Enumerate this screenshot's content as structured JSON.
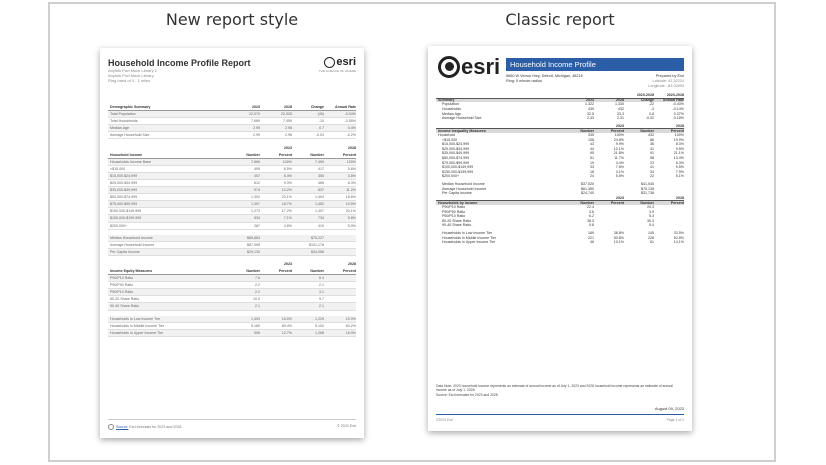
{
  "captions": {
    "new": "New report style",
    "classic": "Classic report"
  },
  "new_report": {
    "title": "Household Income Profile Report",
    "subtitle_lines": [
      "Anyfolk Port Mock Library 2",
      "Anyfolk Port Mock Library",
      "Ring band of 0 - 1 miles"
    ],
    "logo_text": "esri",
    "logo_tagline": "THE SCIENCE OF WHERE",
    "demographic": {
      "header": [
        "Demographic Summary",
        "2023",
        "2028",
        "Change",
        "Annual Rate"
      ],
      "rows": [
        [
          "Total Population",
          "22,970",
          "22,925",
          "(45)",
          "-0.04%"
        ],
        [
          "Total Households",
          "7,669",
          "7,459",
          "-10",
          "-0.55%"
        ],
        [
          "Median Age",
          "2.99",
          "2.96",
          "0.7",
          "0.4%"
        ],
        [
          "Average Household Size",
          "2.99",
          "2.96",
          "-0.03",
          "-0.2%"
        ]
      ]
    },
    "income": {
      "years": [
        "2023",
        "2028"
      ],
      "header": [
        "Household Income",
        "Number",
        "Percent",
        "Number",
        "Percent"
      ],
      "rows": [
        [
          "Households Income Base",
          "7,869",
          "100%",
          "7,459",
          "100%"
        ],
        [
          "<$15,000",
          "495",
          "6.5%",
          "417",
          "5.6%"
        ],
        [
          "$15,000-$24,999",
          "407",
          "5.4%",
          "350",
          "3.8%"
        ],
        [
          "$25,000-$34,999",
          "612",
          "9.3%",
          "465",
          "6.3%"
        ],
        [
          "$35,000-$49,999",
          "974",
          "13.2%",
          "837",
          "11.2%"
        ],
        [
          "$50,000-$74,999",
          "1,302",
          "20.1%",
          "1,404",
          "18.8%"
        ],
        [
          "$75,000-$99,999",
          "1,397",
          "18.7%",
          "1,452",
          "19.5%"
        ],
        [
          "$100,000-$149,999",
          "1,273",
          "17.2%",
          "1,497",
          "20.1%"
        ],
        [
          "$150,000-$199,999",
          "534",
          "7.1%",
          "734",
          "9.8%"
        ],
        [
          "$200,000+",
          "287",
          "3.8%",
          "410",
          "5.0%"
        ]
      ],
      "summary": [
        [
          "Median Household Income",
          "$65,863",
          "$75,227"
        ],
        [
          "Average Household Income",
          "$87,059",
          "$101,178"
        ],
        [
          "Per Capita Income",
          "$29,130",
          "$34,056"
        ]
      ]
    },
    "equity": {
      "years": [
        "2023",
        "2028"
      ],
      "header": [
        "Income Equity Measures",
        "Number",
        "Percent",
        "Number",
        "Percent"
      ],
      "rows": [
        [
          "P90/P10 Ratio",
          "7.6",
          "",
          "6.4",
          ""
        ],
        [
          "P90/P50 Ratio",
          "2.2",
          "",
          "2.1",
          ""
        ],
        [
          "P50/P10 Ratio",
          "2.2",
          "",
          "3.1",
          ""
        ],
        [
          "80-20 Share Ratio",
          "10.0",
          "",
          "9.7",
          ""
        ],
        [
          "90-40 Share Ratio",
          "2.1",
          "",
          "2.1",
          ""
        ]
      ],
      "tiers": [
        [
          "Households in Low Income Tier",
          "1,393",
          "18.5%",
          "1,229",
          "15.9%"
        ],
        [
          "Households in Middle Income Tier",
          "5,180",
          "69.4%",
          "5,102",
          "69.2%"
        ],
        [
          "Households in Upper Income Tier",
          "996",
          "12.7%",
          "1,258",
          "16.9%"
        ]
      ]
    },
    "footer": {
      "source_label": "Source:",
      "source_text": "Esri forecasts for 2023 and 2028.",
      "copyright": "© 2023 Esri"
    }
  },
  "classic_report": {
    "logo_text": "esri",
    "title": "Household Income Profile",
    "address_lines": [
      "5660 W Vernor Hwy, Detroit, Michigan, 48216",
      "Ring: 5 minute radius"
    ],
    "prepared": [
      "Prepared by Esri",
      "Latitude: 42.32224",
      "Longitude: -83.02893"
    ],
    "summary_years": [
      "2023-2028",
      "2023-2028"
    ],
    "summary_header": [
      "Summary",
      "2023",
      "2028",
      "Change",
      "Annual Rate"
    ],
    "summary_rows": [
      [
        "Population",
        "1,322",
        "1,330",
        "-22",
        "-0.43%"
      ],
      [
        "Households",
        "435",
        "432",
        "-3",
        "-0.14%"
      ],
      [
        "Median Age",
        "32.5",
        "33.3",
        "0.8",
        "0.37%"
      ],
      [
        "Average Household Size",
        "2.33",
        "2.31",
        "-0.02",
        "-0.18%"
      ]
    ],
    "income_years": [
      "2023",
      "2028"
    ],
    "income_header": [
      "Income Inequality Measures",
      "Number",
      "Percent",
      "Number",
      "Percent"
    ],
    "income_rows": [
      [
        "Household",
        "435",
        "100%",
        "432",
        "100%"
      ],
      [
        "<$15,000",
        "108",
        "24.8%",
        "86",
        "19.9%"
      ],
      [
        "$15,000-$24,999",
        "43",
        "9.9%",
        "36",
        "8.3%"
      ],
      [
        "$25,000-$34,999",
        "44",
        "10.1%",
        "41",
        "9.5%"
      ],
      [
        "$35,000-$49,999",
        "95",
        "21.8%",
        "91",
        "21.1%"
      ],
      [
        "$50,000-$74,999",
        "51",
        "11.7%",
        "58",
        "13.4%"
      ],
      [
        "$75,000-$99,999",
        "19",
        "4.4%",
        "23",
        "5.3%"
      ],
      [
        "$100,000-$149,999",
        "33",
        "7.6%",
        "41",
        "9.5%"
      ],
      [
        "$150,000-$199,999",
        "18",
        "4.1%",
        "34",
        "7.9%"
      ],
      [
        "$200,000+",
        "24",
        "5.5%",
        "22",
        "5.1%"
      ]
    ],
    "income_summary": [
      [
        "Median Household Income",
        "$37,520",
        "$41,540"
      ],
      [
        "Average Household Income",
        "$61,380",
        "$75,138"
      ],
      [
        "Per Capita Income",
        "$24,740",
        "$31,738"
      ]
    ],
    "ratio_years": [
      "2023",
      "2028"
    ],
    "ratio_header": [
      "Households by Income",
      "Number",
      "Percent",
      "Number",
      "Percent"
    ],
    "ratio_rows": [
      [
        "P90/P10 Ratio",
        "22.4",
        "",
        "20.3",
        ""
      ],
      [
        "P90/P50 Ratio",
        "3.6",
        "",
        "3.9",
        ""
      ],
      [
        "P50/P10 Ratio",
        "6.2",
        "",
        "5.3",
        ""
      ],
      [
        "80-20 Share Ratio",
        "38.3",
        "",
        "30.3",
        ""
      ],
      [
        "90-40 Share Ratio",
        "5.8",
        "",
        "5.4",
        ""
      ]
    ],
    "tier_rows": [
      [
        "Households in Low Income Tier",
        "169",
        "38.8%",
        "145",
        "33.5%"
      ],
      [
        "Households in Middle Income Tier",
        "221",
        "50.8%",
        "228",
        "52.8%"
      ],
      [
        "Households in Upper Income Tier",
        "46",
        "10.1%",
        "61",
        "14.1%"
      ]
    ],
    "note": "Data Note: 2023 household income represents an estimate of annual income as of July 1, 2023 and 2028 household income represents an estimate of annual income as of July 1, 2028.",
    "source": "Source: Esri forecasts for 2023 and 2028.",
    "date": "August 09, 2023",
    "footer_left": "©2023 Esri",
    "footer_right": "Page 1 of 2"
  }
}
